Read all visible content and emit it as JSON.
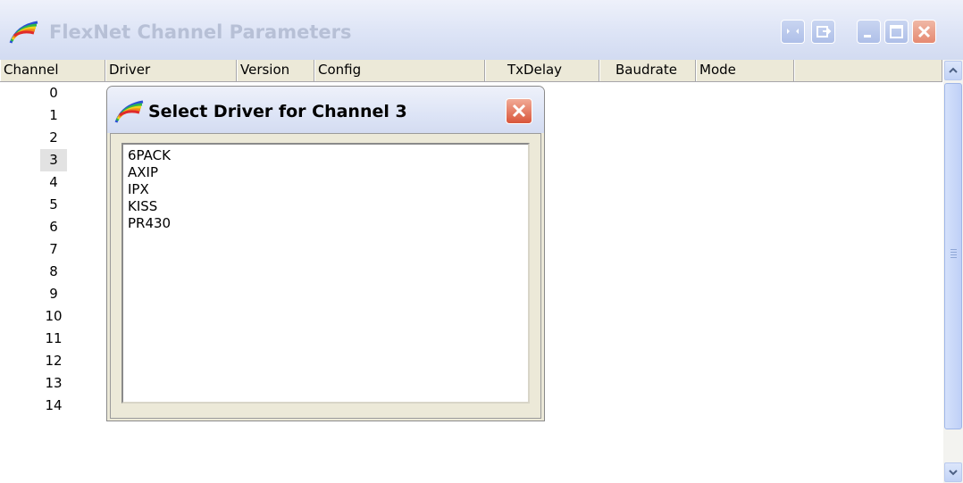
{
  "window": {
    "title": "FlexNet Channel Parameters",
    "state": "inactive",
    "buttons": [
      "pin-icon",
      "export-icon",
      "minimize-icon",
      "maximize-icon",
      "close-icon"
    ]
  },
  "columns": [
    "Channel",
    "Driver",
    "Version",
    "Config",
    "TxDelay",
    "Baudrate",
    "Mode",
    ""
  ],
  "channels": [
    "0",
    "1",
    "2",
    "3",
    "4",
    "5",
    "6",
    "7",
    "8",
    "9",
    "10",
    "11",
    "12",
    "13",
    "14"
  ],
  "selected_channel": "3",
  "dialog": {
    "title": "Select Driver for Channel 3",
    "drivers": [
      "6PACK",
      "AXIP",
      "IPX",
      "KISS",
      "PR430"
    ]
  },
  "colors": {
    "title_inactive": "#b7c0d6",
    "header_bg": "#ece9d8",
    "close_button": "#e06a4e"
  }
}
